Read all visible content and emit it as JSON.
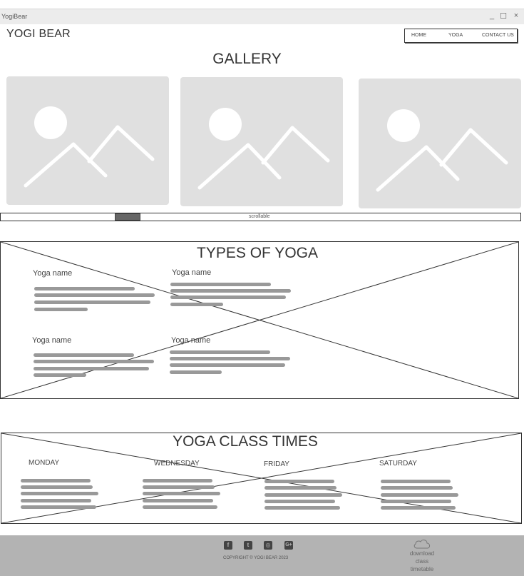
{
  "window": {
    "title": "YogiBear",
    "minimize_glyph": "_",
    "maximize_glyph": "☐",
    "close_glyph": "×"
  },
  "header": {
    "logo": "YOGI BEAR",
    "nav": [
      {
        "label": "HOME"
      },
      {
        "label": "YOGA"
      },
      {
        "label": "CONTACT US"
      }
    ]
  },
  "gallery": {
    "title": "GALLERY",
    "images": [
      {
        "icon": "image-placeholder-icon"
      },
      {
        "icon": "image-placeholder-icon"
      },
      {
        "icon": "image-placeholder-icon"
      }
    ],
    "scroll_label": "scrollable"
  },
  "types": {
    "title": "TYPES OF YOGA",
    "items": [
      {
        "name": "Yoga name"
      },
      {
        "name": "Yoga name"
      },
      {
        "name": "Yoga name"
      },
      {
        "name": "Yoga name"
      }
    ]
  },
  "times": {
    "title": "YOGA CLASS TIMES",
    "days": [
      {
        "name": "MONDAY"
      },
      {
        "name": "WEDNESDAY"
      },
      {
        "name": "FRIDAY"
      },
      {
        "name": "SATURDAY"
      }
    ]
  },
  "footer": {
    "social": [
      {
        "icon": "facebook-icon",
        "glyph": "f"
      },
      {
        "icon": "twitter-icon",
        "glyph": "t"
      },
      {
        "icon": "instagram-icon",
        "glyph": "◎"
      },
      {
        "icon": "google-plus-icon",
        "glyph": "G+"
      }
    ],
    "copyright": "COPYRIGHT © YOGI BEAR 2023",
    "download_label_line1": "download",
    "download_label_line2": "class",
    "download_label_line3": "timetable",
    "download_icon": "cloud-icon"
  },
  "colors": {
    "placeholder_bg": "#e0e0e0",
    "text_line": "#999999",
    "footer_bg": "#b3b3b3"
  }
}
